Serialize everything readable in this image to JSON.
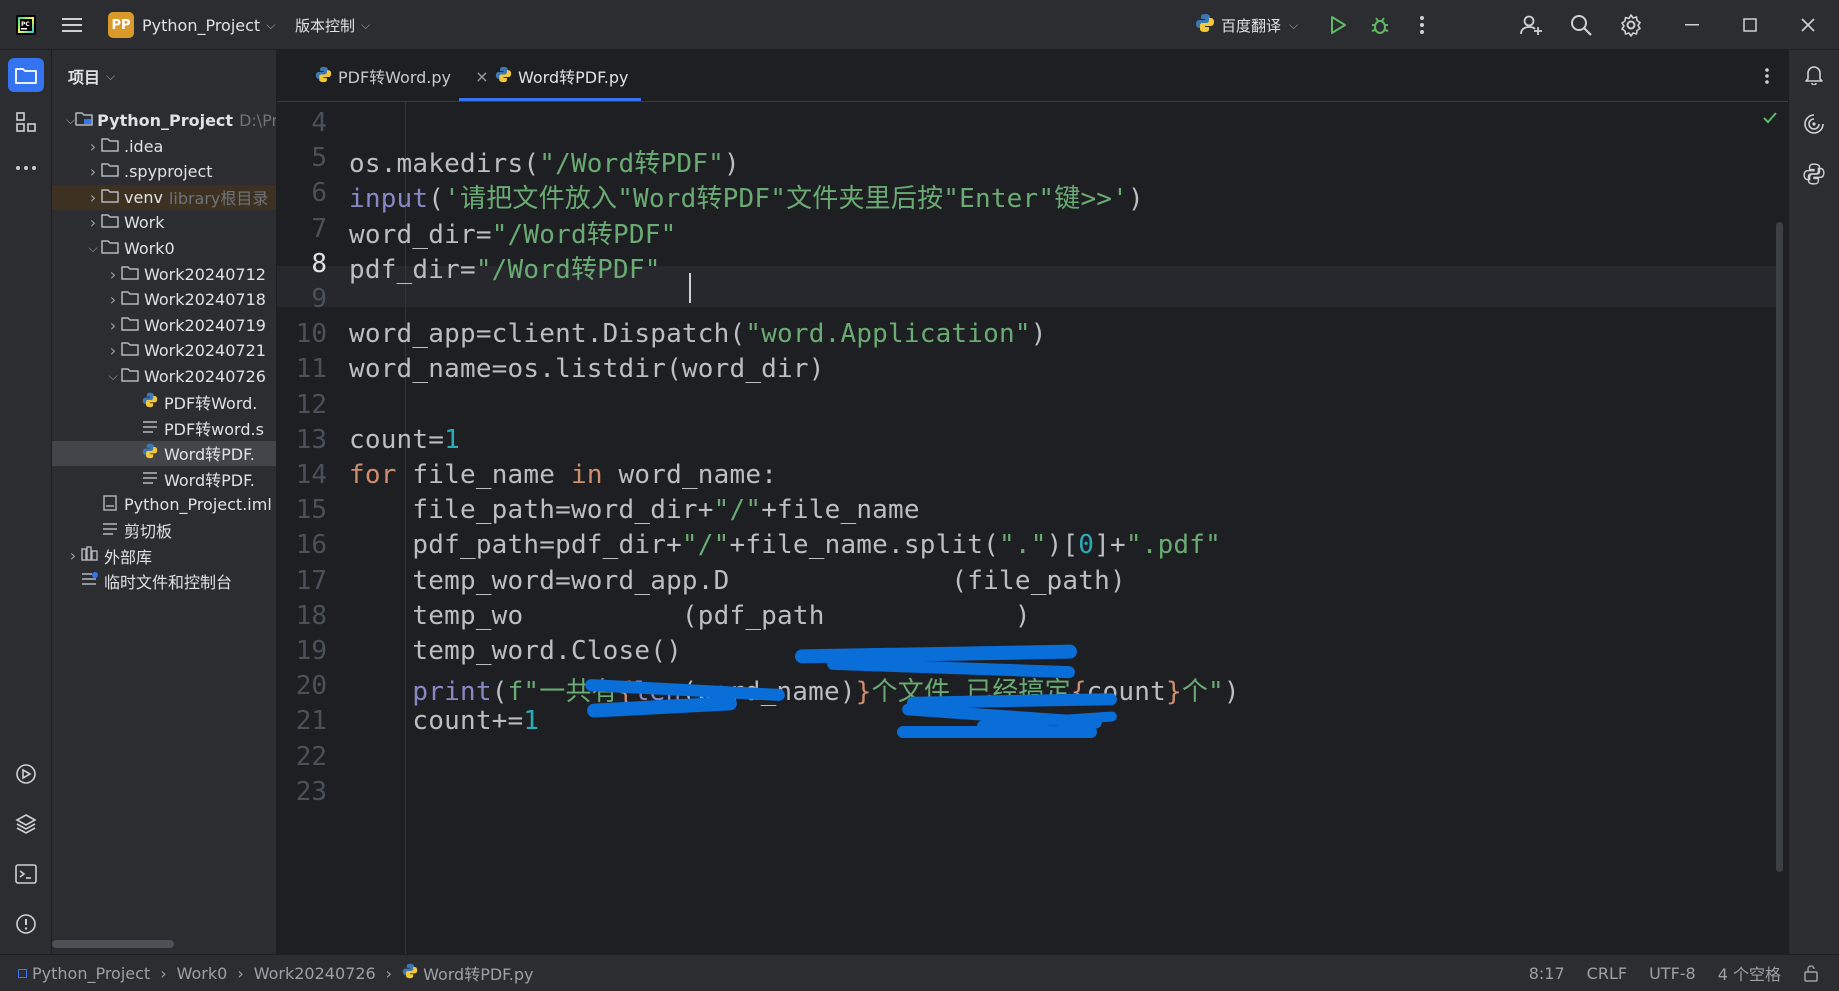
{
  "titlebar": {
    "app_badge": "PP",
    "project_name": "Python_Project",
    "vcs_label": "版本控制",
    "run_config": "百度翻译"
  },
  "tabs": [
    {
      "label": "PDF转Word.py",
      "active": false
    },
    {
      "label": "Word转PDF.py",
      "active": true
    }
  ],
  "sidebar": {
    "header": "项目",
    "tree": [
      {
        "label": "Python_Project",
        "hint": "D:\\Pr",
        "depth": 0,
        "expanded": true,
        "type": "project"
      },
      {
        "label": ".idea",
        "depth": 1,
        "expanded": false,
        "type": "folder"
      },
      {
        "label": ".spyproject",
        "depth": 1,
        "expanded": false,
        "type": "folder"
      },
      {
        "label": "venv",
        "hint": "library根目录",
        "depth": 1,
        "expanded": false,
        "type": "folder"
      },
      {
        "label": "Work",
        "depth": 1,
        "expanded": false,
        "type": "folder"
      },
      {
        "label": "Work0",
        "depth": 1,
        "expanded": true,
        "type": "folder"
      },
      {
        "label": "Work20240712",
        "depth": 2,
        "expanded": false,
        "type": "folder"
      },
      {
        "label": "Work20240718",
        "depth": 2,
        "expanded": false,
        "type": "folder"
      },
      {
        "label": "Work20240719",
        "depth": 2,
        "expanded": false,
        "type": "folder"
      },
      {
        "label": "Work20240721",
        "depth": 2,
        "expanded": false,
        "type": "folder"
      },
      {
        "label": "Work20240726",
        "depth": 2,
        "expanded": true,
        "type": "folder"
      },
      {
        "label": "PDF转Word.",
        "depth": 3,
        "type": "python"
      },
      {
        "label": "PDF转word.s",
        "depth": 3,
        "type": "text"
      },
      {
        "label": "Word转PDF.",
        "depth": 3,
        "type": "python",
        "selected": true
      },
      {
        "label": "Word转PDF.",
        "depth": 3,
        "type": "text"
      },
      {
        "label": "Python_Project.iml",
        "depth": 1,
        "type": "iml"
      },
      {
        "label": "剪切板",
        "depth": 1,
        "type": "text"
      },
      {
        "label": "外部库",
        "depth": 0,
        "expanded": false,
        "type": "library"
      },
      {
        "label": "临时文件和控制台",
        "depth": 0,
        "type": "scratch"
      }
    ]
  },
  "editor": {
    "current_line": 8,
    "lines": [
      {
        "n": "4",
        "tokens": []
      },
      {
        "n": "5",
        "tokens": [
          [
            "t",
            "os.makedirs("
          ],
          [
            "str",
            "\"/Word转PDF\""
          ],
          [
            "t",
            ")"
          ]
        ]
      },
      {
        "n": "6",
        "tokens": [
          [
            "bi",
            "input"
          ],
          [
            "t",
            "("
          ],
          [
            "str",
            "'请把文件放入\"Word转PDF\"文件夹里后按\"Enter\"键>>'"
          ],
          [
            "t",
            ")"
          ]
        ]
      },
      {
        "n": "7",
        "tokens": [
          [
            "t",
            "word_dir="
          ],
          [
            "str",
            "\"/Word转PDF\""
          ]
        ]
      },
      {
        "n": "8",
        "tokens": [
          [
            "t",
            "pdf_dir="
          ],
          [
            "str",
            "\"/Word转PDF\""
          ]
        ]
      },
      {
        "n": "9",
        "tokens": []
      },
      {
        "n": "10",
        "tokens": [
          [
            "t",
            "word_app=client.Dispatch("
          ],
          [
            "str",
            "\"word.Application\""
          ],
          [
            "t",
            ")"
          ]
        ]
      },
      {
        "n": "11",
        "tokens": [
          [
            "t",
            "word_name=os.listdir(word_dir)"
          ]
        ]
      },
      {
        "n": "12",
        "tokens": []
      },
      {
        "n": "13",
        "tokens": [
          [
            "t",
            "count="
          ],
          [
            "num",
            "1"
          ]
        ]
      },
      {
        "n": "14",
        "tokens": [
          [
            "kw",
            "for "
          ],
          [
            "t",
            "file_name "
          ],
          [
            "kw",
            "in "
          ],
          [
            "t",
            "word_name:"
          ]
        ]
      },
      {
        "n": "15",
        "tokens": [
          [
            "t",
            "    file_path=word_dir+"
          ],
          [
            "str",
            "\"/\""
          ],
          [
            "t",
            "+file_name"
          ]
        ]
      },
      {
        "n": "16",
        "tokens": [
          [
            "t",
            "    pdf_path=pdf_dir+"
          ],
          [
            "str",
            "\"/\""
          ],
          [
            "t",
            "+file_name.split("
          ],
          [
            "str",
            "\".\""
          ],
          [
            "t",
            ")["
          ],
          [
            "num",
            "0"
          ],
          [
            "t",
            "]+"
          ],
          [
            "str",
            "\".pdf\""
          ]
        ]
      },
      {
        "n": "17",
        "tokens": [
          [
            "t",
            "    temp_word=word_app.D              (file_path)"
          ]
        ]
      },
      {
        "n": "18",
        "tokens": [
          [
            "t",
            "    temp_wo          (pdf_path            )"
          ]
        ]
      },
      {
        "n": "19",
        "tokens": [
          [
            "t",
            "    temp_word.Close()"
          ]
        ]
      },
      {
        "n": "20",
        "tokens": [
          [
            "t",
            "    "
          ],
          [
            "bi",
            "print"
          ],
          [
            "t",
            "("
          ],
          [
            "str",
            "f\"一共有"
          ],
          [
            "kw",
            "{"
          ],
          [
            "bi",
            "len"
          ],
          [
            "t",
            "(word_name)"
          ],
          [
            "kw",
            "}"
          ],
          [
            "str",
            "个文件,已经搞定"
          ],
          [
            "kw",
            "{"
          ],
          [
            "t",
            "count"
          ],
          [
            "kw",
            "}"
          ],
          [
            "str",
            "个\""
          ],
          [
            "t",
            ")"
          ]
        ]
      },
      {
        "n": "21",
        "tokens": [
          [
            "t",
            "    count+="
          ],
          [
            "num",
            "1"
          ]
        ]
      },
      {
        "n": "22",
        "tokens": []
      },
      {
        "n": "23",
        "tokens": []
      }
    ]
  },
  "statusbar": {
    "breadcrumbs": [
      "Python_Project",
      "Work0",
      "Work20240726",
      "Word转PDF.py"
    ],
    "position": "8:17",
    "line_sep": "CRLF",
    "encoding": "UTF-8",
    "indent": "4 个空格"
  },
  "colors": {
    "keyword": "#cf8e6d",
    "string": "#6aab73",
    "number": "#2aacb8",
    "builtin": "#8888c6",
    "default": "#bcbec4",
    "redaction": "#0a6ed8"
  }
}
